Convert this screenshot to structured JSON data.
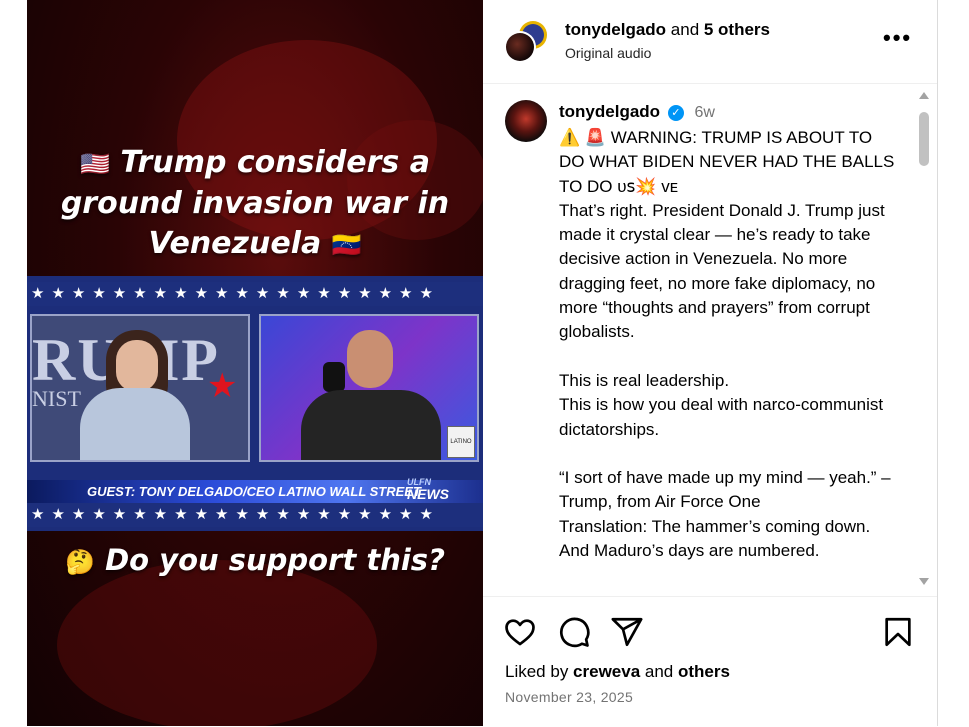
{
  "media": {
    "headline_flag": "🇺🇸",
    "headline_text": "Trump considers a ground invasion war in Venezuela",
    "headline_flag_end": "🇻🇪",
    "wall_text": "RUMP",
    "wall_text_2": "NIST",
    "logo_text": "LATINO",
    "guest_label": "GUEST: TONY DELGADO/CEO LATINO WALL STREET",
    "network_small": "ULFN",
    "network": "NEWS",
    "stars": "★★★★★★★★★★★★★★★★★★★★",
    "question_emoji": "🤔",
    "question": "Do you support this?"
  },
  "header": {
    "account": "tonydelgado",
    "and_text": " and ",
    "others": "5 others",
    "audio": "Original audio",
    "more_label": "•••"
  },
  "post": {
    "author": "tonydelgado",
    "verified_glyph": "✓",
    "age": "6w",
    "caption": "⚠️ 🚨 WARNING: TRUMP IS ABOUT TO DO WHAT BIDEN NEVER HAD THE BALLS TO DO ᴜꜱ💥 ᴠᴇ\nThat’s right. President Donald J. Trump just made it crystal clear — he’s ready to take decisive action in Venezuela. No more dragging feet, no more fake diplomacy, no more “thoughts and prayers” from corrupt globalists.\n\nThis is real leadership.\nThis is how you deal with narco-communist dictatorships.\n\n“I sort of have made up my mind — yeah.” – Trump, from Air Force One\nTranslation: The hammer’s coming down. And Maduro’s days are numbered."
  },
  "actions": {
    "liked_prefix": "Liked by ",
    "liked_user": "creweva",
    "liked_and": " and ",
    "liked_others": "others",
    "date": "November 23, 2025"
  },
  "icons": {
    "like": "heart-icon",
    "comment": "comment-icon",
    "share": "share-icon",
    "save": "bookmark-icon"
  }
}
